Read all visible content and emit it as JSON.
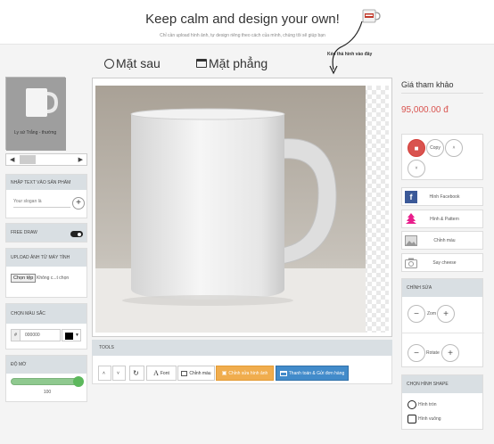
{
  "header": {
    "title": "Keep calm and design your own!",
    "subtitle": "Chỉ cần upload hình ảnh, tự design riêng theo cách của mình, chúng tôi sẽ giúp bạn"
  },
  "tabs": [
    {
      "label": "Mặt sau"
    },
    {
      "label": "Mặt phẳng"
    }
  ],
  "drag_hint": "Kéo thả hình vào đây",
  "product": {
    "thumb_caption": "Ly sứ Trắng - thường"
  },
  "left_panels": {
    "text_input": {
      "heading": "NHẬP TEXT VÀO SẢN PHẨM",
      "placeholder": "Your slogan là"
    },
    "free_draw": {
      "heading": "FREE DRAW"
    },
    "upload": {
      "heading": "UPLOAD ẢNH TỪ MÁY TÍNH",
      "button": "Chọn tệp",
      "status": "Không c...t chọn"
    },
    "color": {
      "heading": "CHỌN MÀU SẮC",
      "prefix": "#",
      "value": "000000",
      "swatch": "#000000"
    },
    "opacity": {
      "heading": "ĐỘ MỜ",
      "value": "100"
    }
  },
  "tools": {
    "heading": "TOOLS",
    "buttons": [
      {
        "label": ""
      },
      {
        "label": ""
      },
      {
        "label": ""
      },
      {
        "label": "Font"
      },
      {
        "label": "Chỉnh màu"
      },
      {
        "label": "Chỉnh sửa hình ảnh"
      },
      {
        "label": "Thanh toán & Gửi đơn hàng"
      }
    ]
  },
  "right": {
    "price_label": "Giá tham khảo",
    "price_value": "95,000.00 đ",
    "copy_label": "Copy",
    "feature_buttons": [
      {
        "label": "Hình Facebook",
        "icon": "facebook-icon"
      },
      {
        "label": "Hình & Pattern",
        "icon": "tree-icon"
      },
      {
        "label": "Chỉnh màu",
        "icon": "image-icon"
      },
      {
        "label": "Say cheese",
        "icon": "camera-icon"
      }
    ],
    "edit_panel": {
      "heading": "CHỈNH SỬA",
      "zoom_label": "Zom",
      "rotate_label": "Rotate"
    },
    "shape_panel": {
      "heading": "CHỌN HÌNH SHAPE",
      "options": [
        "Hình tròn",
        "Hình vuông"
      ]
    }
  },
  "colors": {
    "accent_orange": "#f0ad4e",
    "accent_blue": "#428bca",
    "price_red": "#d9534f",
    "slider_green": "#5cb85c",
    "panel_head": "#d9dfe3"
  }
}
